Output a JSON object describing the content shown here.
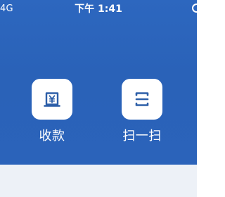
{
  "status_bar": {
    "network": "4G",
    "time": "下午 1:41"
  },
  "actions": [
    {
      "label": "收款",
      "icon": "yuan-receipt-icon"
    },
    {
      "label": "扫一扫",
      "icon": "scan-icon"
    }
  ],
  "colors": {
    "header_blue": "#2b63ba",
    "icon_tile": "#ffffff",
    "icon_ink": "#2d5fa8",
    "lower_panel": "#edf1f7"
  }
}
